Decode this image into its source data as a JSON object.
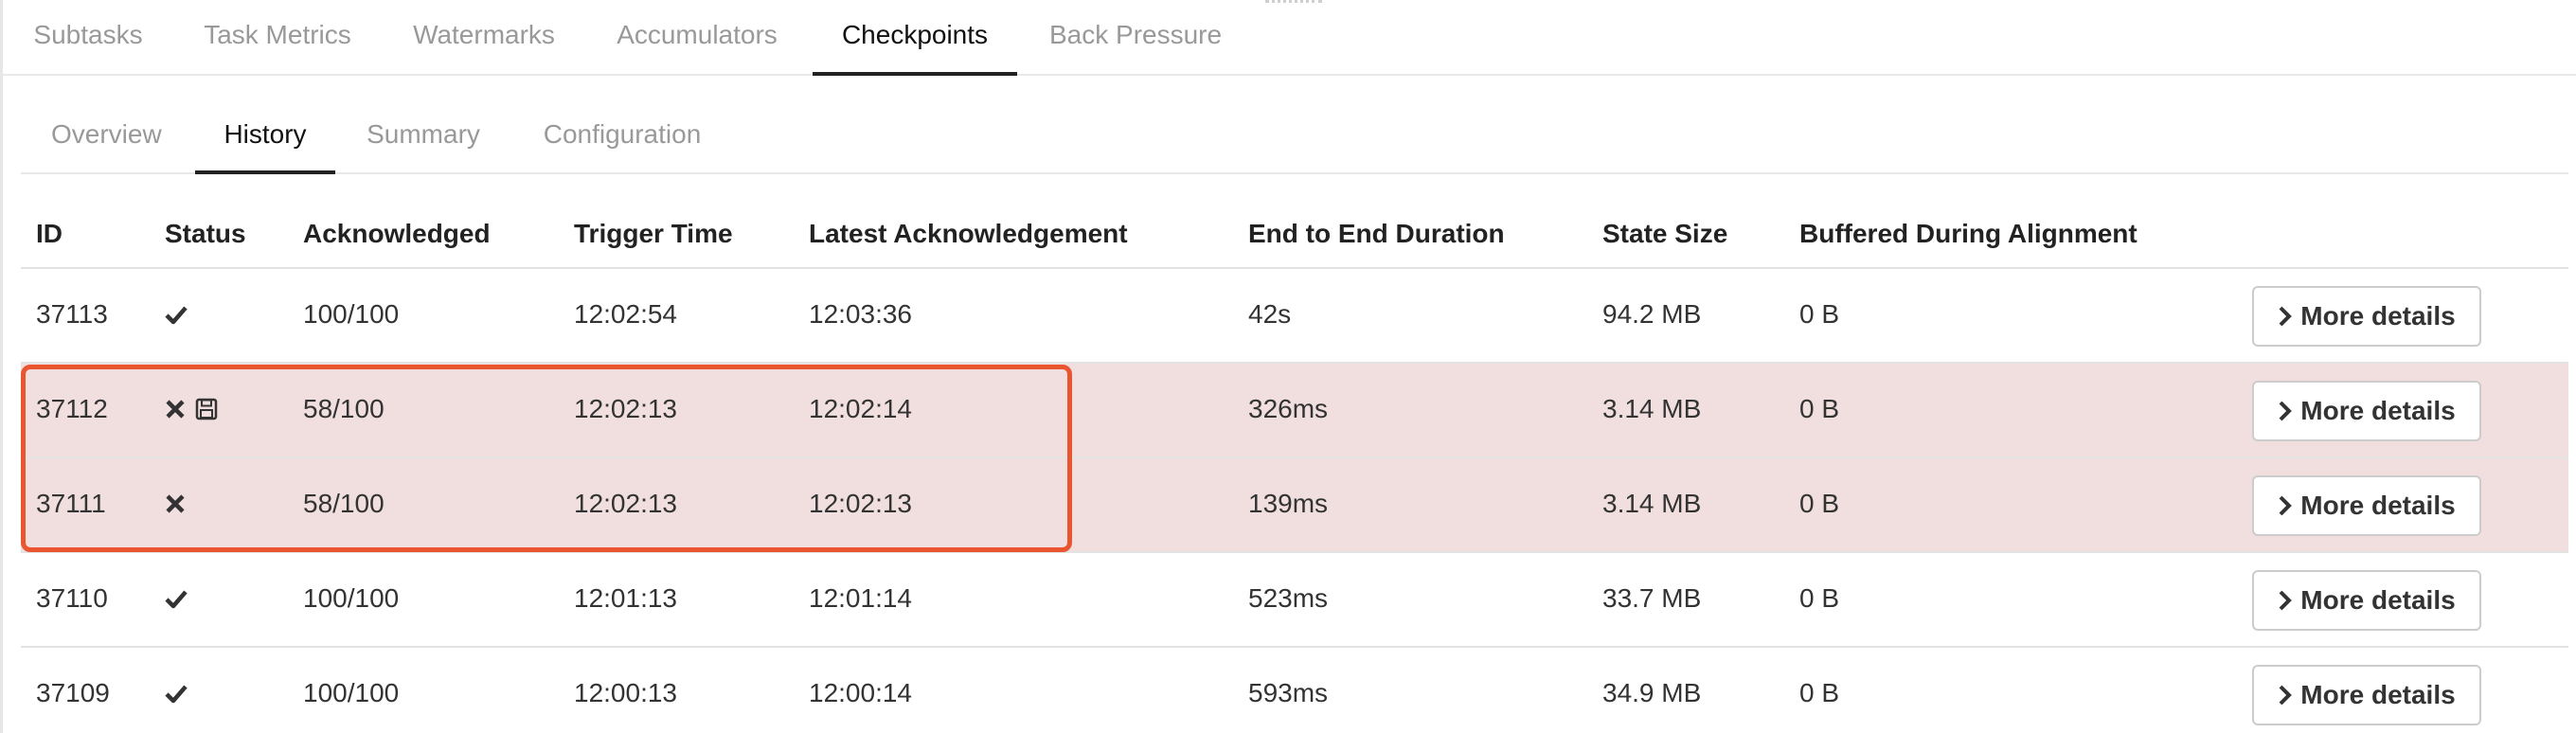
{
  "top_tabs": [
    {
      "label": "Subtasks",
      "active": false
    },
    {
      "label": "Task Metrics",
      "active": false
    },
    {
      "label": "Watermarks",
      "active": false
    },
    {
      "label": "Accumulators",
      "active": false
    },
    {
      "label": "Checkpoints",
      "active": true
    },
    {
      "label": "Back Pressure",
      "active": false
    }
  ],
  "sub_tabs": [
    {
      "label": "Overview",
      "active": false
    },
    {
      "label": "History",
      "active": true
    },
    {
      "label": "Summary",
      "active": false
    },
    {
      "label": "Configuration",
      "active": false
    }
  ],
  "table": {
    "headers": [
      "ID",
      "Status",
      "Acknowledged",
      "Trigger Time",
      "Latest Acknowledgement",
      "End to End Duration",
      "State Size",
      "Buffered During Alignment"
    ],
    "action_label": "More details",
    "rows": [
      {
        "id": "37113",
        "status": "completed",
        "status_icons": [
          "check-icon"
        ],
        "acknowledged": "100/100",
        "trigger_time": "12:02:54",
        "latest_ack": "12:03:36",
        "duration": "42s",
        "state_size": "94.2 MB",
        "buffered": "0 B"
      },
      {
        "id": "37112",
        "status": "failed",
        "status_icons": [
          "cross-icon",
          "savepoint-icon"
        ],
        "acknowledged": "58/100",
        "trigger_time": "12:02:13",
        "latest_ack": "12:02:14",
        "duration": "326ms",
        "state_size": "3.14 MB",
        "buffered": "0 B"
      },
      {
        "id": "37111",
        "status": "failed",
        "status_icons": [
          "cross-icon"
        ],
        "acknowledged": "58/100",
        "trigger_time": "12:02:13",
        "latest_ack": "12:02:13",
        "duration": "139ms",
        "state_size": "3.14 MB",
        "buffered": "0 B"
      },
      {
        "id": "37110",
        "status": "completed",
        "status_icons": [
          "check-icon"
        ],
        "acknowledged": "100/100",
        "trigger_time": "12:01:13",
        "latest_ack": "12:01:14",
        "duration": "523ms",
        "state_size": "33.7 MB",
        "buffered": "0 B"
      },
      {
        "id": "37109",
        "status": "completed",
        "status_icons": [
          "check-icon"
        ],
        "acknowledged": "100/100",
        "trigger_time": "12:00:13",
        "latest_ack": "12:00:14",
        "duration": "593ms",
        "state_size": "34.9 MB",
        "buffered": "0 B"
      }
    ]
  },
  "colors": {
    "failed_row_bg": "#f1dfdf",
    "highlight_border": "#e8552f",
    "active_tab": "#111111",
    "inactive_tab": "#999999"
  }
}
